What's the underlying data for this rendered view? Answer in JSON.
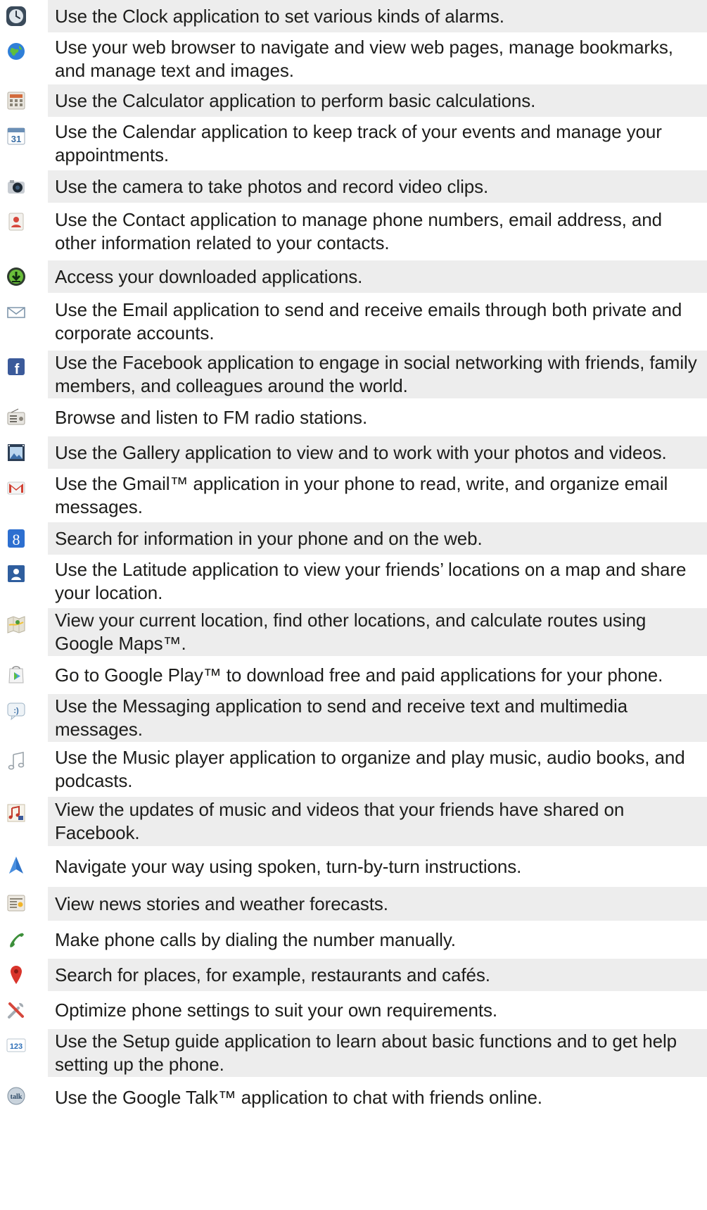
{
  "app_list": [
    {
      "icon": "clock-icon",
      "text": "Use the Clock application to set various kinds of alarms."
    },
    {
      "icon": "browser-globe-icon",
      "text": "Use your web browser to navigate and view web pages, manage bookmarks, and manage text and images."
    },
    {
      "icon": "calculator-icon",
      "text": "Use the Calculator application to perform basic calculations."
    },
    {
      "icon": "calendar-icon",
      "icon_label": "31",
      "text": "Use the Calendar application to keep track of your events and manage your appointments."
    },
    {
      "icon": "camera-icon",
      "text": "Use the camera to take photos and record video clips."
    },
    {
      "icon": "contacts-icon",
      "text": "Use the Contact application to manage phone numbers, email address, and other information related to your contacts."
    },
    {
      "icon": "download-icon",
      "text": "Access your downloaded applications."
    },
    {
      "icon": "email-envelope-icon",
      "text": "Use the Email application to send and receive emails through both private and corporate accounts."
    },
    {
      "icon": "facebook-icon",
      "icon_label": "f",
      "text": "Use the Facebook application to engage in social networking with friends, family members, and colleagues around the world."
    },
    {
      "icon": "fm-radio-icon",
      "text": "Browse and listen to FM radio stations."
    },
    {
      "icon": "gallery-icon",
      "text": "Use the Gallery application to view and to work with your photos and videos."
    },
    {
      "icon": "gmail-icon",
      "icon_label": "M",
      "text": "Use the Gmail™ application in your phone to read, write, and organize email messages."
    },
    {
      "icon": "google-search-icon",
      "icon_label": "8",
      "text": "Search for information in your phone and on the web."
    },
    {
      "icon": "latitude-icon",
      "text": "Use the Latitude application to view your friends’ locations on a map and share your location."
    },
    {
      "icon": "maps-icon",
      "text": "View your current location, find other locations, and calculate routes using Google Maps™."
    },
    {
      "icon": "play-store-icon",
      "text": "Go to Google Play™ to download free and paid applications for your phone."
    },
    {
      "icon": "messaging-icon",
      "icon_label": ":)",
      "text": "Use the Messaging application to send and receive text and multimedia messages."
    },
    {
      "icon": "music-note-icon",
      "text": "Use the Music player application to organize and play music, audio books, and podcasts."
    },
    {
      "icon": "music-video-icon",
      "text": "View the updates of music and videos that your friends have shared on Facebook."
    },
    {
      "icon": "navigation-arrow-icon",
      "text": "Navigate your way using spoken, turn-by-turn instructions."
    },
    {
      "icon": "news-weather-icon",
      "text": "View news stories and weather forecasts."
    },
    {
      "icon": "phone-handset-icon",
      "text": "Make phone calls by dialing the number manually."
    },
    {
      "icon": "places-pin-icon",
      "text": "Search for places, for example, restaurants and cafés."
    },
    {
      "icon": "settings-tools-icon",
      "text": "Optimize phone settings to suit your own requirements."
    },
    {
      "icon": "setup-guide-icon",
      "icon_label": "123",
      "text": "Use the Setup guide application to learn about basic functions and to get help setting up the phone."
    },
    {
      "icon": "talk-icon",
      "icon_label": "talk",
      "text": "Use the Google Talk™ application to chat with friends online."
    }
  ],
  "colors": {
    "row_shade": "#ededed",
    "text": "#1d1d1b"
  }
}
